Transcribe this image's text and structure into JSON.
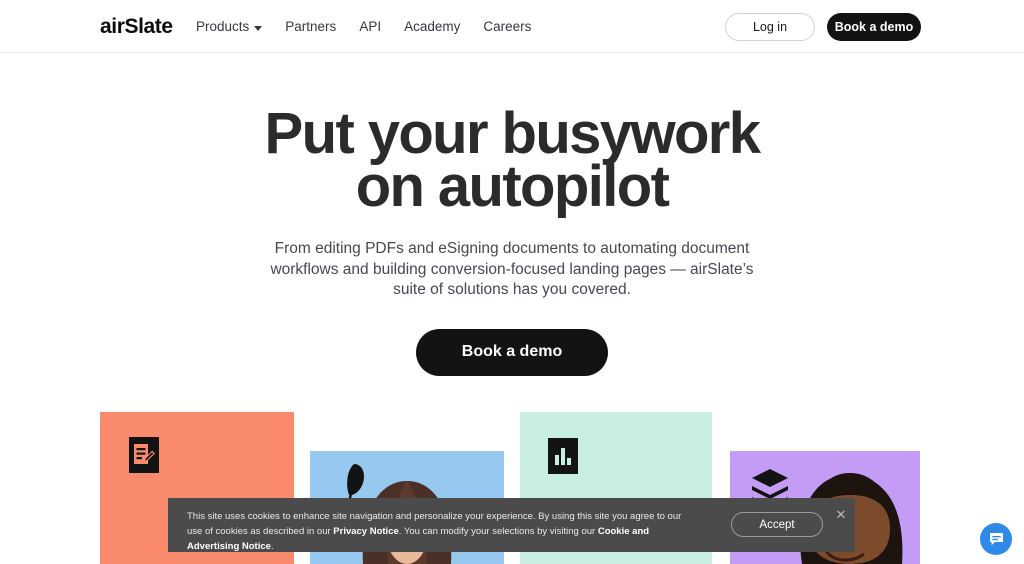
{
  "header": {
    "logo": "airSlate",
    "nav": [
      {
        "label": "Products",
        "has_caret": true,
        "icon": "chevron-down-icon"
      },
      {
        "label": "Partners",
        "has_caret": false
      },
      {
        "label": "API",
        "has_caret": false
      },
      {
        "label": "Academy",
        "has_caret": false
      },
      {
        "label": "Careers",
        "has_caret": false
      }
    ],
    "login_label": "Log in",
    "demo_label": "Book a demo"
  },
  "hero": {
    "title_line1": "Put your busywork",
    "title_line2": "on autopilot",
    "subtitle": "From editing PDFs and eSigning documents to automating document workflows and building conversion-focused landing pages — airSlate’s suite of solutions has you covered.",
    "cta_label": "Book a demo"
  },
  "cards": [
    {
      "name": "card-pdf-editor",
      "color": "#F98B6C",
      "icon": "document-edit-icon",
      "kind": "solid"
    },
    {
      "name": "card-esign",
      "color": "#96C8F0",
      "icon": "feather-pen-icon",
      "kind": "photo"
    },
    {
      "name": "card-analytics",
      "color": "#C8EFE2",
      "icon": "bar-chart-icon",
      "kind": "solid"
    },
    {
      "name": "card-workflows",
      "color": "#C49BF5",
      "icon": "layers-icon",
      "kind": "photo"
    }
  ],
  "cookie_banner": {
    "text_part1": "This site uses cookies to enhance site navigation and personalize your experience. By using this site you agree to our use of cookies as described in our ",
    "link1": "Privacy Notice",
    "text_part2": ". You can modify your selections by visiting our ",
    "link2": "Cookie and Advertising Notice",
    "text_part3": ".",
    "accept_label": "Accept",
    "close_icon": "close-icon",
    "background": "#4b4b4b"
  },
  "chat_widget": {
    "icon": "chat-bubble-icon",
    "color": "#2e8ae6"
  },
  "colors": {
    "dark_button": "#131313",
    "text_primary": "#2b2b2b",
    "text_secondary": "#434a50"
  }
}
